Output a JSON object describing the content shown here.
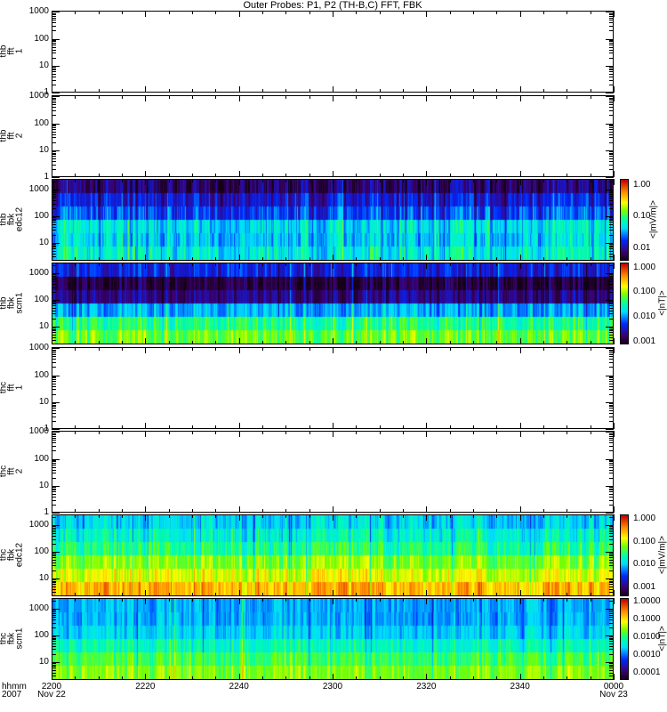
{
  "title": "Outer Probes: P1, P2 (TH-B,C) FFT, FBK",
  "x_axis": {
    "row_labels": [
      "hhmm",
      "2007"
    ],
    "ticks": [
      "2200",
      "2220",
      "2240",
      "2300",
      "2320",
      "2340",
      "0000"
    ],
    "dates": {
      "first": "Nov 22",
      "last": "Nov 23"
    }
  },
  "chart_data": [
    {
      "type": "heatmap",
      "label": [
        "thb",
        "fft",
        "1"
      ],
      "ylim": [
        1,
        1100
      ],
      "yticks": [
        "1",
        "10",
        "100",
        "1000"
      ],
      "empty": true
    },
    {
      "type": "heatmap",
      "label": [
        "thb",
        "fft",
        "2"
      ],
      "ylim": [
        1,
        1100
      ],
      "yticks": [
        "1",
        "10",
        "100",
        "1000"
      ],
      "empty": true
    },
    {
      "type": "heatmap",
      "label": [
        "thb",
        "fbk",
        "edc12"
      ],
      "ylim": [
        2.1,
        2500
      ],
      "yticks": [
        "10",
        "100",
        "1000"
      ],
      "empty": false,
      "colorbar": {
        "title": "<|mV/m|>",
        "ticks": [
          "0.01",
          "0.10",
          "1.00"
        ],
        "range_log": [
          -2.4,
          0.2
        ]
      },
      "band_levels_frac": [
        0.45,
        0.4,
        0.42,
        0.27,
        0.2,
        0.1
      ],
      "variability": 0.12
    },
    {
      "type": "heatmap",
      "label": [
        "thb",
        "fbk",
        "scm1"
      ],
      "ylim": [
        2.1,
        2500
      ],
      "yticks": [
        "10",
        "100",
        "1000"
      ],
      "empty": false,
      "colorbar": {
        "title": "<|nT|>",
        "ticks": [
          "0.001",
          "0.010",
          "0.100",
          "1.000"
        ],
        "range_log": [
          -3.1,
          0.2
        ]
      },
      "band_levels_frac": [
        0.6,
        0.52,
        0.36,
        0.12,
        0.05,
        0.22
      ],
      "variability": 0.1
    },
    {
      "type": "heatmap",
      "label": [
        "thc",
        "fft",
        "1"
      ],
      "ylim": [
        1,
        1100
      ],
      "yticks": [
        "1",
        "10",
        "100",
        "1000"
      ],
      "empty": true
    },
    {
      "type": "heatmap",
      "label": [
        "thc",
        "fft",
        "2"
      ],
      "ylim": [
        1,
        1100
      ],
      "yticks": [
        "1",
        "10",
        "100",
        "1000"
      ],
      "empty": true
    },
    {
      "type": "heatmap",
      "label": [
        "thc",
        "fbk",
        "edc12"
      ],
      "ylim": [
        2.1,
        2500
      ],
      "yticks": [
        "10",
        "100",
        "1000"
      ],
      "empty": false,
      "colorbar": {
        "title": "<|mV/m|>",
        "ticks": [
          "0.001",
          "0.010",
          "0.100",
          "1.000"
        ],
        "range_log": [
          -3.4,
          0.2
        ]
      },
      "band_levels_frac": [
        0.8,
        0.7,
        0.62,
        0.52,
        0.46,
        0.4
      ],
      "variability": 0.1
    },
    {
      "type": "heatmap",
      "label": [
        "thc",
        "fbk",
        "scm1"
      ],
      "ylim": [
        2.1,
        2500
      ],
      "yticks": [
        "10",
        "100",
        "1000"
      ],
      "empty": false,
      "colorbar": {
        "title": "<|nT|>",
        "ticks": [
          "0.0001",
          "0.0010",
          "0.0100",
          "0.1000",
          "1.0000"
        ],
        "range_log": [
          -4.4,
          0.2
        ]
      },
      "band_levels_frac": [
        0.62,
        0.56,
        0.48,
        0.4,
        0.36,
        0.36
      ],
      "variability": 0.08
    }
  ]
}
